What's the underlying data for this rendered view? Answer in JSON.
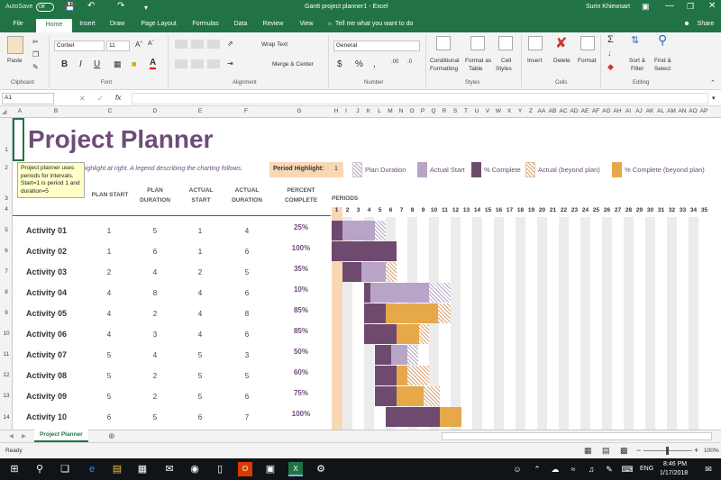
{
  "window": {
    "autosave": "AutoSave",
    "autosave_state": "Off",
    "title": "Gantt project planner1  -  Excel",
    "user": "Surin Khiewsart"
  },
  "tabs": [
    "File",
    "Home",
    "Insert",
    "Draw",
    "Page Layout",
    "Formulas",
    "Data",
    "Review",
    "View"
  ],
  "tell_me": "Tell me what you want to do",
  "share": "Share",
  "ribbon": {
    "paste": "Paste",
    "clipboard": "Clipboard",
    "font_name": "Corbel",
    "font_size": "11",
    "font": "Font",
    "wrap_text": "Wrap Text",
    "merge_center": "Merge & Center",
    "alignment": "Alignment",
    "number_format": "General",
    "number": "Number",
    "conditional": "Conditional",
    "formatting": "Formatting",
    "format_as": "Format as",
    "table": "Table",
    "cell": "Cell",
    "styles_btn": "Styles",
    "styles": "Styles",
    "insert": "Insert",
    "delete": "Delete",
    "format": "Format",
    "cells": "Cells",
    "sort": "Sort &",
    "filter": "Filter",
    "find": "Find &",
    "select": "Select",
    "editing": "Editing"
  },
  "formula_bar": {
    "name_box": "A1",
    "fx": "fx",
    "value": ""
  },
  "columns": [
    "A",
    "B",
    "C",
    "D",
    "E",
    "F",
    "G",
    "H",
    "I",
    "J",
    "K",
    "L",
    "M",
    "N",
    "O",
    "P",
    "Q",
    "R",
    "S",
    "T",
    "U",
    "V",
    "W",
    "X",
    "Y",
    "Z",
    "AA",
    "AB",
    "AC",
    "AD",
    "AE",
    "AF",
    "AG",
    "AH",
    "AI",
    "AJ",
    "AK",
    "AL",
    "AM",
    "AN",
    "AO",
    "AP"
  ],
  "rows": [
    "1",
    "2",
    "3",
    "4",
    "5",
    "6",
    "7",
    "8",
    "9",
    "10",
    "11",
    "12",
    "13",
    "14"
  ],
  "sheet": {
    "title": "Project Planner",
    "subtitle": "highlight at right.  A legend describing the charting follows.",
    "tooltip": "Project planner uses periods for intervals. Start=1 is period 1 and duration=5",
    "period_highlight_label": "Period Highlight:",
    "period_highlight_value": "1",
    "legend": [
      "Plan Duration",
      "Actual Start",
      "% Complete",
      "Actual (beyond plan)",
      "% Complete (beyond plan)"
    ],
    "headers": {
      "plan_start": "PLAN START",
      "plan_duration": "PLAN DURATION",
      "actual_start": "ACTUAL START",
      "actual_duration": "ACTUAL DURATION",
      "percent_complete": "PERCENT COMPLETE",
      "periods": "PERIODS"
    },
    "periods": [
      "1",
      "2",
      "3",
      "4",
      "5",
      "6",
      "7",
      "8",
      "9",
      "10",
      "11",
      "12",
      "13",
      "14",
      "15",
      "16",
      "17",
      "18",
      "19",
      "20",
      "21",
      "22",
      "23",
      "24",
      "25",
      "26",
      "27",
      "28",
      "29",
      "30",
      "31",
      "32",
      "33",
      "34",
      "35"
    ],
    "activities": [
      {
        "name": "Activity 01",
        "plan_start": "1",
        "plan_duration": "5",
        "actual_start": "1",
        "actual_duration": "4",
        "percent": "25%"
      },
      {
        "name": "Activity 02",
        "plan_start": "1",
        "plan_duration": "6",
        "actual_start": "1",
        "actual_duration": "6",
        "percent": "100%"
      },
      {
        "name": "Activity 03",
        "plan_start": "2",
        "plan_duration": "4",
        "actual_start": "2",
        "actual_duration": "5",
        "percent": "35%"
      },
      {
        "name": "Activity 04",
        "plan_start": "4",
        "plan_duration": "8",
        "actual_start": "4",
        "actual_duration": "6",
        "percent": "10%"
      },
      {
        "name": "Activity 05",
        "plan_start": "4",
        "plan_duration": "2",
        "actual_start": "4",
        "actual_duration": "8",
        "percent": "85%"
      },
      {
        "name": "Activity 06",
        "plan_start": "4",
        "plan_duration": "3",
        "actual_start": "4",
        "actual_duration": "6",
        "percent": "85%"
      },
      {
        "name": "Activity 07",
        "plan_start": "5",
        "plan_duration": "4",
        "actual_start": "5",
        "actual_duration": "3",
        "percent": "50%"
      },
      {
        "name": "Activity 08",
        "plan_start": "5",
        "plan_duration": "2",
        "actual_start": "5",
        "actual_duration": "5",
        "percent": "60%"
      },
      {
        "name": "Activity 09",
        "plan_start": "5",
        "plan_duration": "2",
        "actual_start": "5",
        "actual_duration": "6",
        "percent": "75%"
      },
      {
        "name": "Activity 10",
        "plan_start": "6",
        "plan_duration": "5",
        "actual_start": "6",
        "actual_duration": "7",
        "percent": "100%"
      }
    ]
  },
  "sheet_tab": "Project Planner",
  "status": {
    "ready": "Ready",
    "zoom": "100%"
  },
  "taskbar": {
    "time": "8:46 PM",
    "date": "1/17/2018",
    "lang": "ENG"
  },
  "colors": {
    "excel_green": "#217346",
    "title_purple": "#6e4c7a",
    "complete": "#6f4a6f",
    "actual": "#b8a4c6",
    "beyond": "#e6a848",
    "highlight": "#f9d7b5"
  }
}
